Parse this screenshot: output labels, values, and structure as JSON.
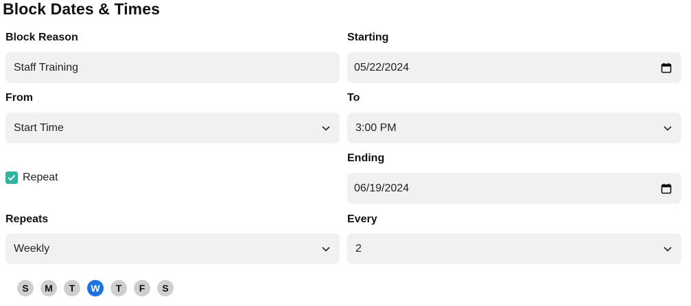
{
  "title": "Block Dates & Times",
  "block_reason": {
    "label": "Block Reason",
    "value": "Staff Training"
  },
  "starting": {
    "label": "Starting",
    "value": "05/22/2024",
    "icon": "calendar-icon"
  },
  "from": {
    "label": "From",
    "value": "Start Time",
    "icon": "chevron-down-icon"
  },
  "to": {
    "label": "To",
    "value": "3:00 PM",
    "icon": "chevron-down-icon"
  },
  "repeat": {
    "label": "Repeat",
    "checked": true,
    "color": "#2ab5a1"
  },
  "ending": {
    "label": "Ending",
    "value": "06/19/2024",
    "icon": "calendar-icon"
  },
  "repeats": {
    "label": "Repeats",
    "value": "Weekly",
    "icon": "chevron-down-icon"
  },
  "every": {
    "label": "Every",
    "value": "2",
    "icon": "chevron-down-icon"
  },
  "days": [
    {
      "label": "S",
      "selected": false
    },
    {
      "label": "M",
      "selected": false
    },
    {
      "label": "T",
      "selected": false
    },
    {
      "label": "W",
      "selected": true
    },
    {
      "label": "T",
      "selected": false
    },
    {
      "label": "F",
      "selected": false
    },
    {
      "label": "S",
      "selected": false
    }
  ],
  "colors": {
    "field_bg": "#f0f1f3",
    "accent": "#1a73e8",
    "day_bg": "#cfcfd2"
  }
}
